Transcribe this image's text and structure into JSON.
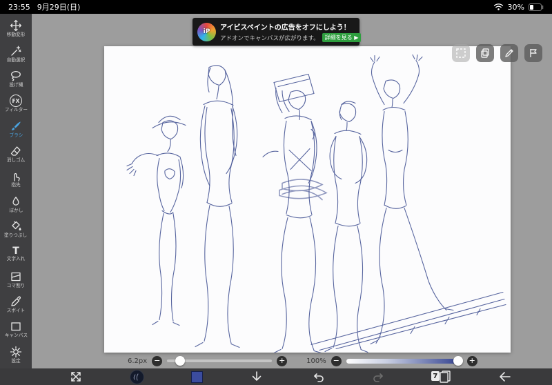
{
  "status_bar": {
    "time": "23:55",
    "date": "9月29日(日)",
    "battery": "30%"
  },
  "ad_banner": {
    "logo": "iP",
    "title": "アイビスペイントの広告をオフにしよう！",
    "subtitle": "アドオンでキャンバスが広がります。",
    "cta": "詳細を見る ▶"
  },
  "left_toolbar": {
    "items": [
      {
        "label": "移動変形",
        "icon": "move-transform-icon"
      },
      {
        "label": "自動選択",
        "icon": "magic-wand-icon"
      },
      {
        "label": "投げ縄",
        "icon": "lasso-icon"
      },
      {
        "label": "フィルター",
        "icon": "fx-filter-icon",
        "glyph": "FX"
      },
      {
        "label": "ブラシ",
        "icon": "brush-icon",
        "active": true
      },
      {
        "label": "消しゴム",
        "icon": "eraser-icon"
      },
      {
        "label": "指先",
        "icon": "finger-icon"
      },
      {
        "label": "ぼかし",
        "icon": "blur-drop-icon"
      },
      {
        "label": "塗りつぶし",
        "icon": "paint-bucket-icon"
      },
      {
        "label": "文字入れ",
        "icon": "text-tool-icon",
        "glyph": "T"
      },
      {
        "label": "コマ割り",
        "icon": "panel-frame-icon"
      },
      {
        "label": "スポイト",
        "icon": "eyedropper-icon"
      },
      {
        "label": "キャンバス",
        "icon": "canvas-icon"
      },
      {
        "label": "設定",
        "icon": "gear-icon"
      }
    ]
  },
  "canvas_toolbar": {
    "icons": [
      "dashed-selection-icon",
      "clipboard-icon",
      "pencil-icon",
      "flag-icon"
    ]
  },
  "sliders": {
    "brush_size_value": "6.2px",
    "opacity_value": "100%",
    "minus_glyph": "−",
    "plus_glyph": "+"
  },
  "bottom_toolbar": {
    "layers_count": "7"
  },
  "colors": {
    "current_color": "#3b4c9e",
    "sketch_stroke": "#3a4a8e",
    "active_tool": "#4aa3e0",
    "cta_green": "#2e9e3e"
  }
}
